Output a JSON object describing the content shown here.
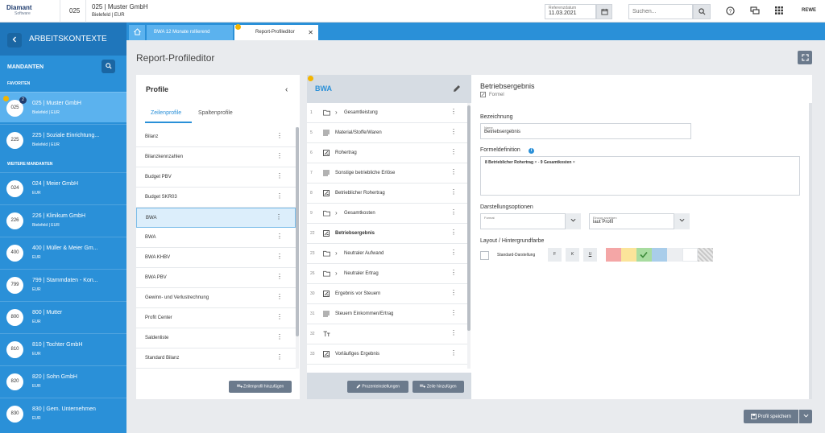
{
  "header": {
    "logo_line1": "Diamant",
    "logo_line2": "Software",
    "client_code": "025",
    "client_name": "025 | Muster GmbH",
    "client_sub": "Bielefeld | EUR",
    "reference_date_label": "Referenzdatum",
    "reference_date": "11.03.2021",
    "search_placeholder": "Suchen...",
    "user": "REWE"
  },
  "sidebar": {
    "title": "ARBEITSKONTEXTE",
    "mandanten_label": "MANDANTEN",
    "favorites_label": "FAVORITEN",
    "others_label": "WEITERE MANDANTEN",
    "favorites": [
      {
        "code": "025",
        "name": "025 | Muster GmbH",
        "sub": "Bielefeld | EUR",
        "badge": "2"
      },
      {
        "code": "225",
        "name": "225 | Soziale Einrichtung...",
        "sub": "Bielefeld | EUR"
      }
    ],
    "others": [
      {
        "code": "024",
        "name": "024 | Meier GmbH",
        "sub": "EUR"
      },
      {
        "code": "226",
        "name": "226 | Klinikum GmbH",
        "sub": "Bielefeld | EUR"
      },
      {
        "code": "400",
        "name": "400 | Müller & Meier Gm...",
        "sub": "EUR"
      },
      {
        "code": "799",
        "name": "799 | Stammdaten - Kon...",
        "sub": "EUR"
      },
      {
        "code": "800",
        "name": "800 | Mutter",
        "sub": "EUR"
      },
      {
        "code": "810",
        "name": "810 | Tochter GmbH",
        "sub": "EUR"
      },
      {
        "code": "820",
        "name": "820 | Sohn GmbH",
        "sub": "EUR"
      },
      {
        "code": "830",
        "name": "830 | Gem. Unternehmen",
        "sub": "EUR"
      }
    ]
  },
  "tabs": {
    "tab1": "BWA 12 Monate rollierend",
    "tab2": "Report-Profileditor"
  },
  "page_title": "Report-Profileditor",
  "profiles": {
    "title": "Profile",
    "tab_rows": "Zeilenprofile",
    "tab_cols": "Spaltenprofile",
    "items": [
      "Bilanz",
      "Bilanzkennzahlen",
      "Budget PBV",
      "Budget SKR03",
      "BWA",
      "BWA",
      "BWA KHBV",
      "BWA PBV",
      "Gewinn- und Verlustrechnung",
      "Profit Center",
      "Saldenliste",
      "Standard Bilanz"
    ],
    "add_button": "Zeilenprofil hinzufügen"
  },
  "bwa": {
    "title": "BWA",
    "rows": [
      {
        "num": "1",
        "icon": "folder",
        "chevron": true,
        "label": "Gesamtleistung"
      },
      {
        "num": "5",
        "icon": "list",
        "label": "Material/Stoffe/Waren"
      },
      {
        "num": "6",
        "icon": "formula",
        "label": "Rohertrag"
      },
      {
        "num": "7",
        "icon": "list",
        "label": "Sonstige betriebliche Erlöse"
      },
      {
        "num": "8",
        "icon": "formula",
        "label": "Betrieblicher Rohertrag"
      },
      {
        "num": "9",
        "icon": "folder",
        "chevron": true,
        "label": "Gesamtkosten"
      },
      {
        "num": "22",
        "icon": "formula",
        "label": "Betriebsergebnis",
        "bold": true
      },
      {
        "num": "23",
        "icon": "folder",
        "chevron": true,
        "label": "Neutraler Aufwand"
      },
      {
        "num": "26",
        "icon": "folder",
        "chevron": true,
        "label": "Neutraler Ertrag"
      },
      {
        "num": "30",
        "icon": "formula",
        "label": "Ergebnis vor Steuern"
      },
      {
        "num": "31",
        "icon": "list",
        "label": "Steuern Einkommen/Ertrag"
      },
      {
        "num": "32",
        "icon": "text",
        "label": ""
      },
      {
        "num": "33",
        "icon": "formula",
        "label": "Vorläufiges Ergebnis"
      },
      {
        "num": "",
        "icon": "text",
        "label": ""
      }
    ],
    "btn_percent": "Prozenteinstellungen",
    "btn_add_row": "Zeile hinzufügen"
  },
  "detail": {
    "title": "Betriebsergebnis",
    "subtitle": "Formel",
    "bezeichnung_label": "Bezeichnung",
    "name_field_label": "Name",
    "name_value": "Betriebsergebnis",
    "formula_label": "Formeldefinition",
    "formula_tokens": [
      "8 Betrieblicher Rohertrag",
      "-",
      "9 Gesamtkosten"
    ],
    "display_label": "Darstellungsoptionen",
    "format_label": "Format",
    "einzug_label": "Einzug anzeigen",
    "einzug_value": "laut Profil",
    "layout_label": "Layout / Hintergrundfarbe",
    "standard_label": "Standard-Darstellung",
    "fmt_bold": "F",
    "fmt_italic": "K",
    "fmt_underline": "U",
    "swatches": [
      "#f4a6a6",
      "#fbe49a",
      "#a8dca0",
      "#a9cdea",
      "#eceef1",
      "#ffffff",
      "#c8c8c8"
    ]
  },
  "save_button": "Profil speichern"
}
